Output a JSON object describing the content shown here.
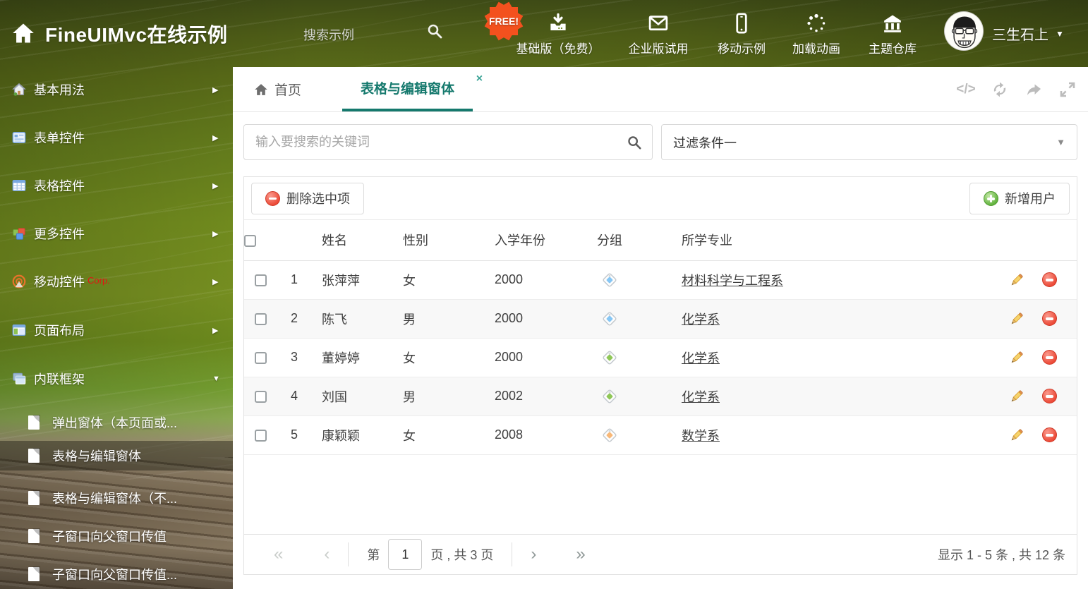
{
  "header": {
    "title": "FineUIMvc在线示例",
    "search_placeholder": "搜索示例",
    "free_badge": "FREE!",
    "nav_items": [
      {
        "label": "基础版（免费）",
        "icon": "download-icon"
      },
      {
        "label": "企业版试用",
        "icon": "envelope-icon"
      },
      {
        "label": "移动示例",
        "icon": "mobile-icon"
      },
      {
        "label": "加载动画",
        "icon": "spinner-icon"
      },
      {
        "label": "主题仓库",
        "icon": "bank-icon"
      }
    ],
    "user_name": "三生石上"
  },
  "sidebar": {
    "items": [
      {
        "label": "基本用法",
        "icon": "home-icon"
      },
      {
        "label": "表单控件",
        "icon": "form-icon"
      },
      {
        "label": "表格控件",
        "icon": "grid-icon"
      },
      {
        "label": "更多控件",
        "icon": "cubes-icon"
      },
      {
        "label": "移动控件",
        "badge": "Corp.",
        "icon": "beacon-icon"
      },
      {
        "label": "页面布局",
        "icon": "layout-icon"
      },
      {
        "label": "内联框架",
        "icon": "frames-icon"
      }
    ],
    "subitems": [
      "弹出窗体（本页面或...",
      "表格与编辑窗体",
      "表格与编辑窗体（不...",
      "子窗口向父窗口传值",
      "子窗口向父窗口传值..."
    ]
  },
  "tabs": {
    "home_label": "首页",
    "active_label": "表格与编辑窗体",
    "close_glyph": "×"
  },
  "viewbar": {
    "code_glyph": "</>"
  },
  "filter": {
    "search_placeholder": "输入要搜索的关键词",
    "dropdown_value": "过滤条件一",
    "dropdown_caret": "▼"
  },
  "toolbar": {
    "delete_label": "删除选中项",
    "add_label": "新增用户"
  },
  "table": {
    "columns": [
      "姓名",
      "性别",
      "入学年份",
      "分组",
      "所学专业"
    ],
    "rows": [
      {
        "index": 1,
        "name": "张萍萍",
        "gender": "女",
        "year": "2000",
        "tag_color": "#86c6f4",
        "major": "材料科学与工程系"
      },
      {
        "index": 2,
        "name": "陈飞",
        "gender": "男",
        "year": "2000",
        "tag_color": "#86c6f4",
        "major": "化学系"
      },
      {
        "index": 3,
        "name": "董婷婷",
        "gender": "女",
        "year": "2000",
        "tag_color": "#8fc757",
        "major": "化学系"
      },
      {
        "index": 4,
        "name": "刘国",
        "gender": "男",
        "year": "2002",
        "tag_color": "#8fc757",
        "major": "化学系"
      },
      {
        "index": 5,
        "name": "康颖颖",
        "gender": "女",
        "year": "2008",
        "tag_color": "#f8b878",
        "major": "数学系"
      }
    ]
  },
  "pagination": {
    "first_glyph": "«",
    "prev_glyph": "‹",
    "next_glyph": "›",
    "last_glyph": "»",
    "page_prefix": "第",
    "current_page": "1",
    "page_suffix": "页 , 共 3 页",
    "summary": "显示 1 - 5 条 , 共 12 条"
  },
  "sidebar_arrows": {
    "collapsed": "▶",
    "expanded": "▼"
  },
  "colors": {
    "accent": "#15796d",
    "danger": "#ec4a38",
    "success": "#62b33e",
    "badge_bg": "#f3511e",
    "tag_blue": "#86c6f4",
    "tag_green": "#8fc757",
    "tag_orange": "#f8b878"
  }
}
